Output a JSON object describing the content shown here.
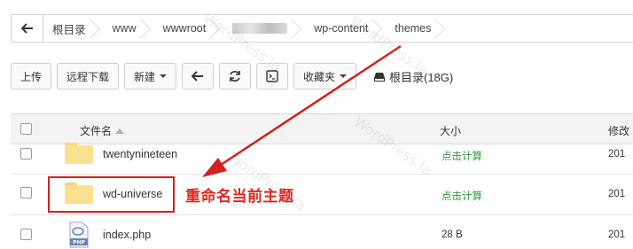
{
  "breadcrumb": {
    "back_icon": "back-arrow-icon",
    "items": [
      "根目录",
      "www",
      "wwwroot",
      "",
      "wp-content",
      "themes"
    ]
  },
  "toolbar": {
    "upload": "上传",
    "remote_download": "远程下载",
    "new": "新建",
    "back_icon": "back-arrow-icon",
    "refresh_icon": "refresh-icon",
    "terminal_icon": "terminal-icon",
    "favorites": "收藏夹",
    "disk_label": "根目录(18G)",
    "disk_icon": "hard-drive-icon"
  },
  "table": {
    "col_name": "文件名",
    "col_size": "大小",
    "col_modified": "修改",
    "rows": [
      {
        "name": "twentynineteen",
        "size": "点击计算",
        "date": "201"
      },
      {
        "name": "wd-universe",
        "size": "点击计算",
        "date": "201"
      },
      {
        "name": "index.php",
        "size": "28 B",
        "date": "201"
      }
    ]
  },
  "annotation": "重命名当前主题",
  "watermark": "WordPress.la",
  "colors": {
    "annotation": "#e0261d",
    "size_link": "#2f9a3a",
    "folder": "#fbe08f"
  }
}
